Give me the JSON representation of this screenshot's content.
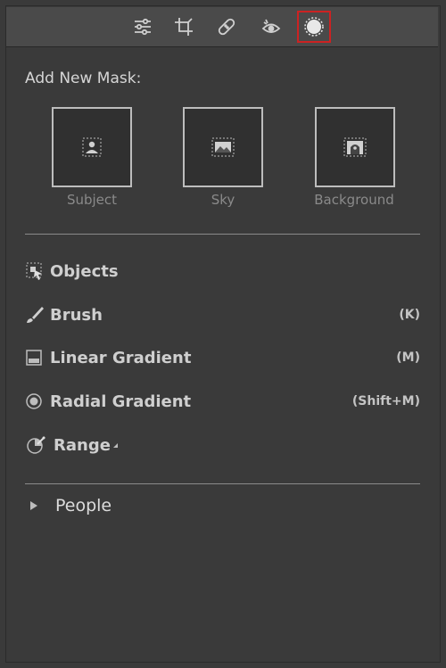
{
  "toolbar": {
    "tools": [
      {
        "name": "edit-sliders-icon"
      },
      {
        "name": "crop-icon"
      },
      {
        "name": "heal-bandage-icon"
      },
      {
        "name": "red-eye-icon"
      },
      {
        "name": "masking-icon",
        "active": true
      }
    ],
    "active_outline_color": "#cc2222"
  },
  "mask_panel": {
    "title": "Add New Mask:",
    "presets": [
      {
        "label": "Subject",
        "icon": "subject-person-icon"
      },
      {
        "label": "Sky",
        "icon": "sky-landscape-icon"
      },
      {
        "label": "Background",
        "icon": "background-arch-icon"
      }
    ]
  },
  "tools": [
    {
      "label": "Objects",
      "shortcut": "",
      "icon": "objects-select-icon"
    },
    {
      "label": "Brush",
      "shortcut": "(K)",
      "icon": "brush-icon"
    },
    {
      "label": "Linear Gradient",
      "shortcut": "(M)",
      "icon": "linear-gradient-icon"
    },
    {
      "label": "Radial Gradient",
      "shortcut": "(Shift+M)",
      "icon": "radial-gradient-icon"
    },
    {
      "label": "Range",
      "shortcut": "",
      "icon": "range-icon"
    }
  ],
  "people": {
    "label": "People"
  }
}
